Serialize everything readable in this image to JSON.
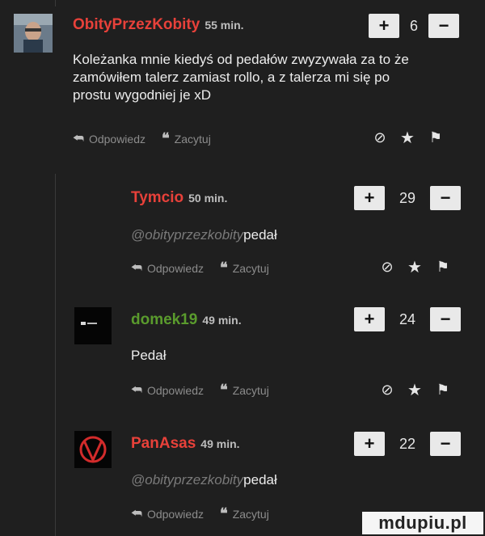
{
  "comments": [
    {
      "author": "ObityPrzezKobity",
      "time": "55 min.",
      "votes": "6",
      "body_lines": [
        "Koleżanka mnie kiedyś od pedałów zwyzywała za to że",
        "zamówiłem talerz zamiast rollo, a z talerza mi się po",
        "prostu wygodniej je xD"
      ]
    },
    {
      "author": "Tymcio",
      "time": "50 min.",
      "votes": "29",
      "mention": "@obityprzezkobity",
      "body": "pedał"
    },
    {
      "author": "domek19",
      "time": "49 min.",
      "votes": "24",
      "body": "Pedał"
    },
    {
      "author": "PanAsas",
      "time": "49 min.",
      "votes": "22",
      "mention": "@obityprzezkobity",
      "body": "pedał"
    }
  ],
  "ui": {
    "plus": "+",
    "minus": "−",
    "reply_label": "Odpowiedz",
    "quote_label": "Zacytuj"
  },
  "icons": {
    "reply": "reply-arrow-icon",
    "quote": "quote-icon",
    "block": "block-user-icon",
    "favorite": "star-icon",
    "report": "flag-icon"
  },
  "watermark": "mdupiu.pl"
}
